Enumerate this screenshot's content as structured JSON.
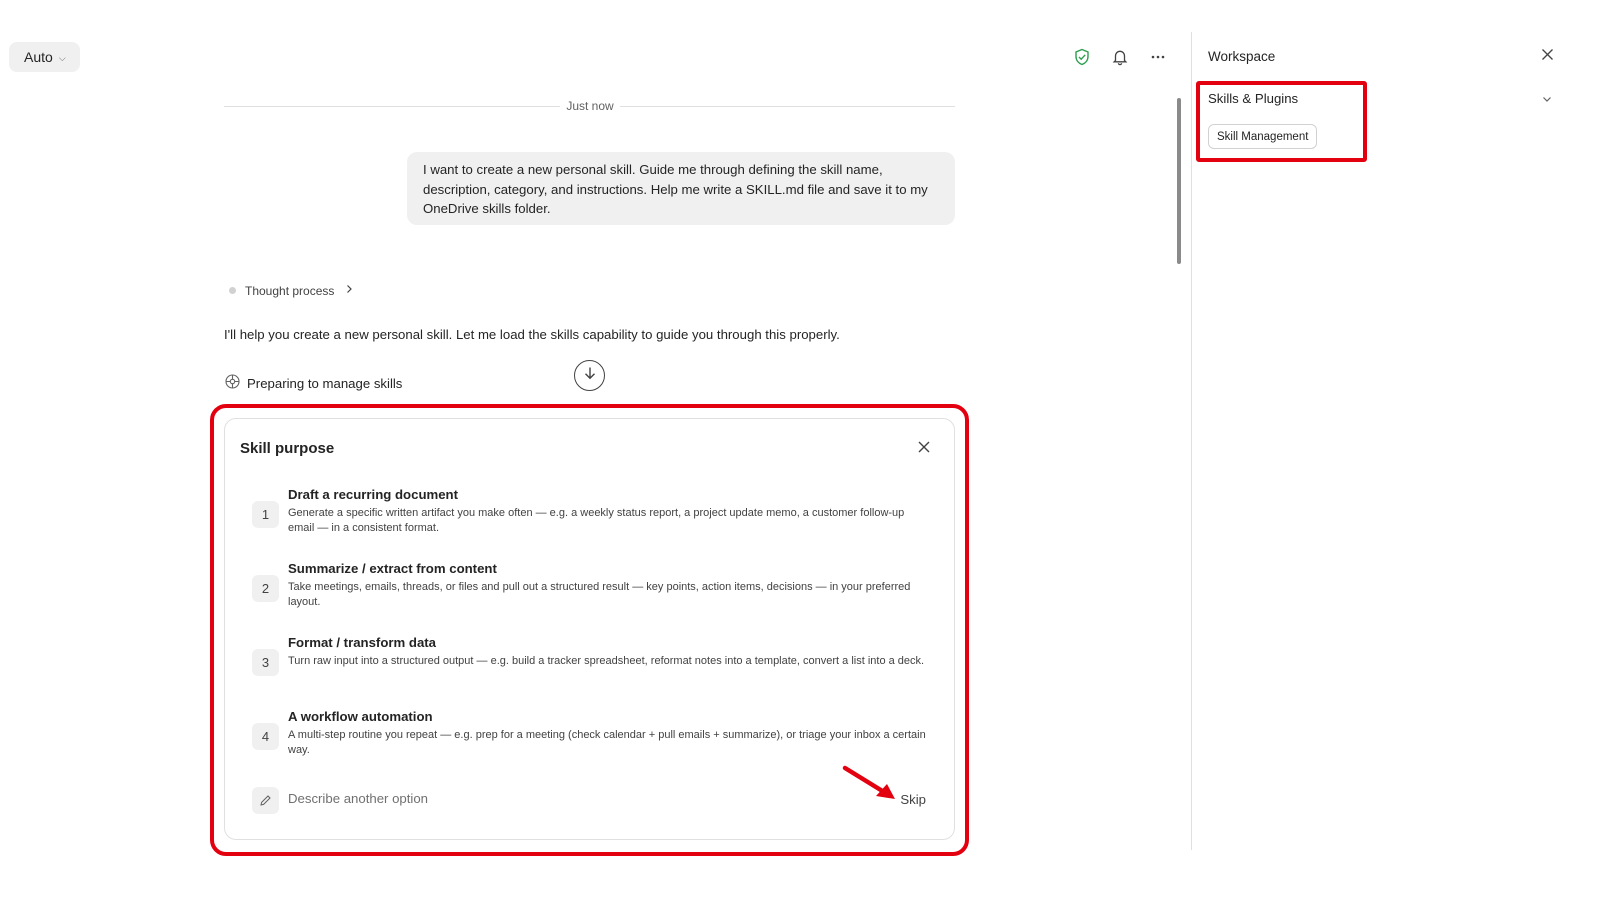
{
  "toolbar": {
    "mode_label": "Auto",
    "icons": [
      "shield-check-icon",
      "bell-icon",
      "more-icon"
    ]
  },
  "colors": {
    "accent_green": "#2e9e4f",
    "highlight_red": "#e3000f"
  },
  "chat": {
    "timestamp": "Just now",
    "user_message": "I want to create a new personal skill. Guide me through defining the skill name, description, category, and instructions. Help me write a SKILL.md file and save it to my OneDrive skills folder.",
    "thought_label": "Thought process",
    "assistant_message": "I'll help you create a new personal skill. Let me load the skills capability to guide you through this properly.",
    "status_text": "Preparing to manage skills"
  },
  "card": {
    "title": "Skill purpose",
    "options": [
      {
        "number": "1",
        "title": "Draft a recurring document",
        "description": "Generate a specific written artifact you make often — e.g. a weekly status report, a project update memo, a customer follow-up email — in a consistent format."
      },
      {
        "number": "2",
        "title": "Summarize / extract from content",
        "description": "Take meetings, emails, threads, or files and pull out a structured result — key points, action items, decisions — in your preferred layout."
      },
      {
        "number": "3",
        "title": "Format / transform data",
        "description": "Turn raw input into a structured output — e.g. build a tracker spreadsheet, reformat notes into a template, convert a list into a deck."
      },
      {
        "number": "4",
        "title": "A workflow automation",
        "description": "A multi-step routine you repeat — e.g. prep for a meeting (check calendar + pull emails + summarize), or triage your inbox a certain way."
      }
    ],
    "other_placeholder": "Describe another option",
    "skip_label": "Skip"
  },
  "workspace": {
    "title": "Workspace",
    "section_title": "Skills & Plugins",
    "chip_label": "Skill Management"
  }
}
